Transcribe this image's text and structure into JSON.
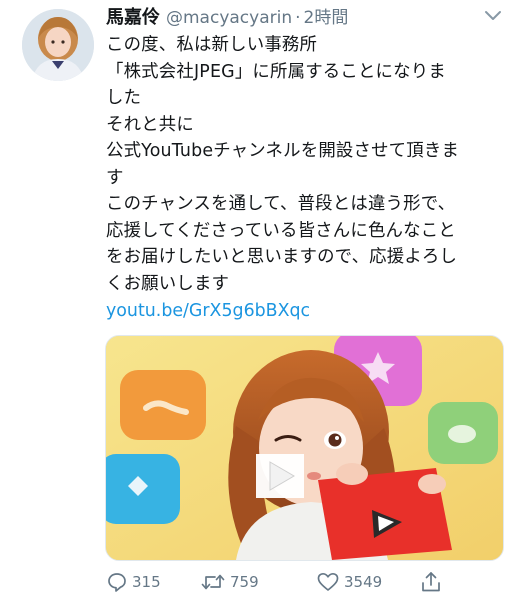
{
  "tweet": {
    "author": {
      "display_name": "馬嘉伶",
      "handle": "@macyacyarin",
      "separator": "·",
      "time": "2時間"
    },
    "text_lines": [
      "この度、私は新しい事務所",
      "「株式会社JPEG」に所属することになりま",
      "した",
      "それと共に",
      "公式YouTubeチャンネルを開設させて頂きま",
      "す",
      "このチャンスを通して、普段とは違う形で、",
      "応援してくださっている皆さんに色んなこと",
      "をお届けしたいと思いますので、応援よろし",
      "くお願いします"
    ],
    "link": "youtu.be/GrX5g6bBXqc",
    "actions": {
      "reply_count": "315",
      "retweet_count": "759",
      "like_count": "3549"
    },
    "icons": {
      "caret": "chevron-down-icon",
      "reply": "reply-icon",
      "retweet": "retweet-icon",
      "like": "heart-icon",
      "share": "share-icon"
    },
    "colors": {
      "text": "#14171a",
      "secondary": "#657786",
      "link": "#1b95e0"
    }
  }
}
